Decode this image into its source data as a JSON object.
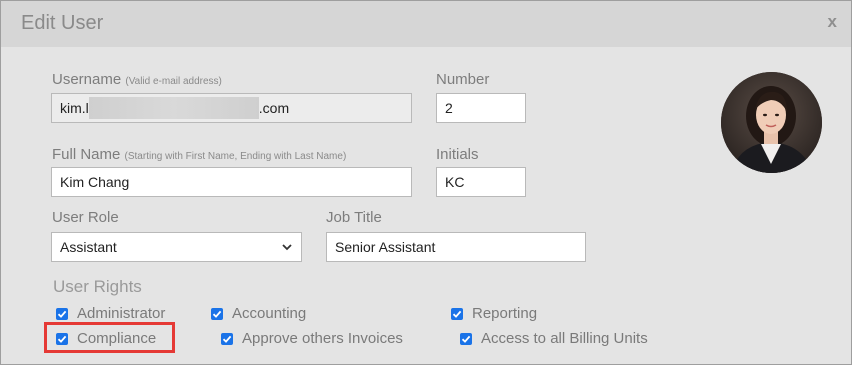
{
  "dialog": {
    "title": "Edit User",
    "close_label": "x"
  },
  "form": {
    "username": {
      "label": "Username",
      "hint": "(Valid e-mail address)",
      "value_prefix": "kim.l",
      "value_suffix": ".com"
    },
    "number": {
      "label": "Number",
      "value": "2"
    },
    "full_name": {
      "label": "Full Name",
      "hint": "(Starting with First Name, Ending with Last Name)",
      "value": "Kim Chang"
    },
    "initials": {
      "label": "Initials",
      "value": "KC"
    },
    "user_role": {
      "label": "User Role",
      "value": "Assistant"
    },
    "job_title": {
      "label": "Job Title",
      "value": "Senior Assistant"
    }
  },
  "rights": {
    "title": "User Rights",
    "items": [
      {
        "label": "Administrator",
        "checked": true
      },
      {
        "label": "Accounting",
        "checked": true
      },
      {
        "label": "Reporting",
        "checked": true
      },
      {
        "label": "Compliance",
        "checked": true
      },
      {
        "label": "Approve others Invoices",
        "checked": true
      },
      {
        "label": "Access to all Billing Units",
        "checked": true
      }
    ]
  },
  "colors": {
    "accent": "#1a73e8",
    "highlight": "#e53935"
  }
}
